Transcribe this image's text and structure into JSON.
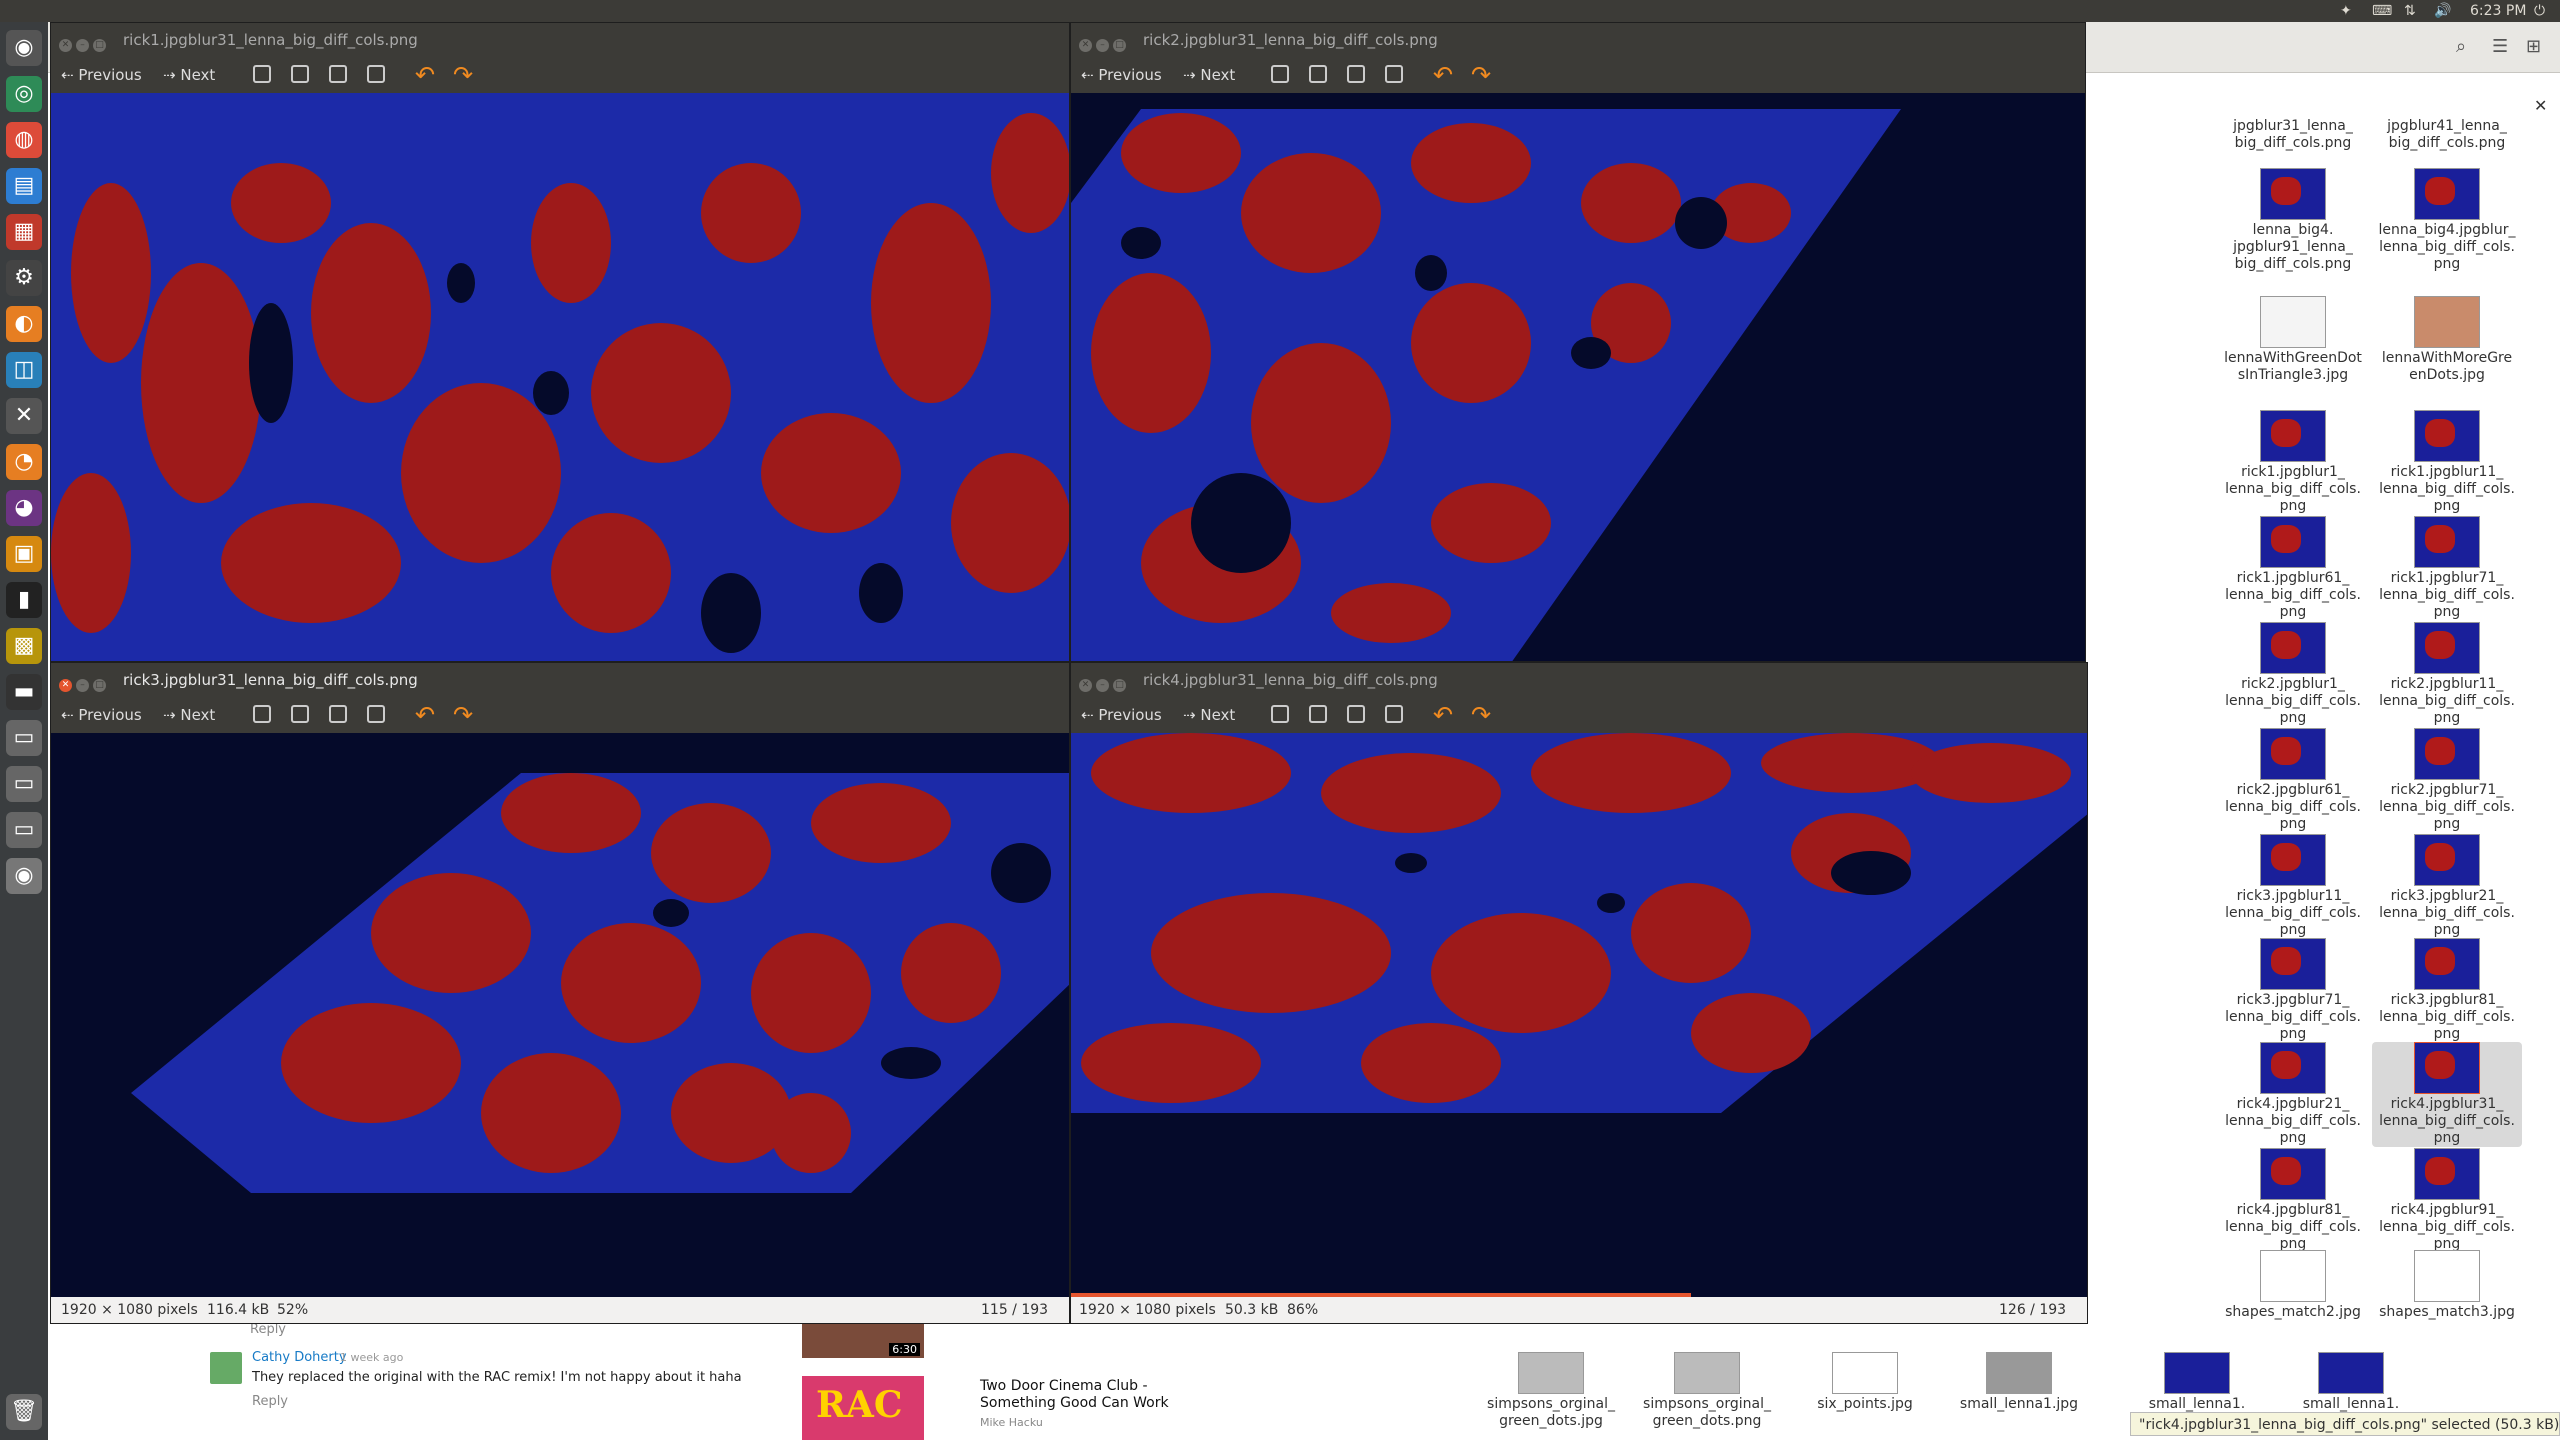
{
  "panel": {
    "time": "6:23 PM"
  },
  "windows": [
    {
      "title": "rick1.jpgblur31_lenna_big_diff_cols.png",
      "prev": "Previous",
      "next": "Next"
    },
    {
      "title": "rick2.jpgblur31_lenna_big_diff_cols.png",
      "prev": "Previous",
      "next": "Next"
    },
    {
      "title": "rick3.jpgblur31_lenna_big_diff_cols.png",
      "prev": "Previous",
      "next": "Next",
      "dims": "1920 × 1080 pixels",
      "size": "116.4 kB",
      "zoom": "52%",
      "index": "115 / 193"
    },
    {
      "title": "rick4.jpgblur31_lenna_big_diff_cols.png",
      "prev": "Previous",
      "next": "Next",
      "dims": "1920 × 1080 pixels",
      "size": "50.3 kB",
      "zoom": "86%",
      "index": "126 / 193"
    }
  ],
  "files": [
    [
      "jpgblur31_lenna_ big_diff_cols.png",
      "jpgblur41_lenna_ big_diff_cols.png"
    ],
    [
      "lenna_big4. jpgblur91_lenna_ big_diff_cols.png",
      "lenna_big4.jpgblur_ lenna_big_diff_cols. png"
    ],
    [
      "lennaWithGreenDot sInTriangle3.jpg",
      "lennaWithMoreGre enDots.jpg"
    ],
    [
      "rick1.jpgblur1_ lenna_big_diff_cols. png",
      "rick1.jpgblur11_ lenna_big_diff_cols. png"
    ],
    [
      "rick1.jpgblur61_ lenna_big_diff_cols. png",
      "rick1.jpgblur71_ lenna_big_diff_cols. png"
    ],
    [
      "rick2.jpgblur1_ lenna_big_diff_cols. png",
      "rick2.jpgblur11_ lenna_big_diff_cols. png"
    ],
    [
      "rick2.jpgblur61_ lenna_big_diff_cols. png",
      "rick2.jpgblur71_ lenna_big_diff_cols. png"
    ],
    [
      "rick3.jpgblur11_ lenna_big_diff_cols. png",
      "rick3.jpgblur21_ lenna_big_diff_cols. png"
    ],
    [
      "rick3.jpgblur71_ lenna_big_diff_cols. png",
      "rick3.jpgblur81_ lenna_big_diff_cols. png"
    ],
    [
      "rick4.jpgblur21_ lenna_big_diff_cols. png",
      "rick4.jpgblur31_ lenna_big_diff_cols. png"
    ],
    [
      "rick4.jpgblur81_ lenna_big_diff_cols. png",
      "rick4.jpgblur91_ lenna_big_diff_cols. png"
    ],
    [
      "shapes_match2.jpg",
      "shapes_match3.jpg"
    ]
  ],
  "bottom_files": [
    "simpsons_orginal_ green_dots.jpg",
    "simpsons_orginal_ green_dots.png",
    "six_points.jpg",
    "small_lenna1.jpg",
    "small_lenna1.",
    "small_lenna1."
  ],
  "status": "\"rick4.jpgblur31_lenna_big_diff_cols.png\" selected (50.3 kB)",
  "browser": {
    "reply": "Reply",
    "commenter": "Cathy Doherty",
    "when": "1 week ago",
    "comment": "They replaced the original with the RAC remix! I'm not happy about it haha",
    "video_title": "Two Door Cinema Club - Something Good Can Work",
    "channel": "Mike Hacku",
    "duration": "6:30"
  }
}
